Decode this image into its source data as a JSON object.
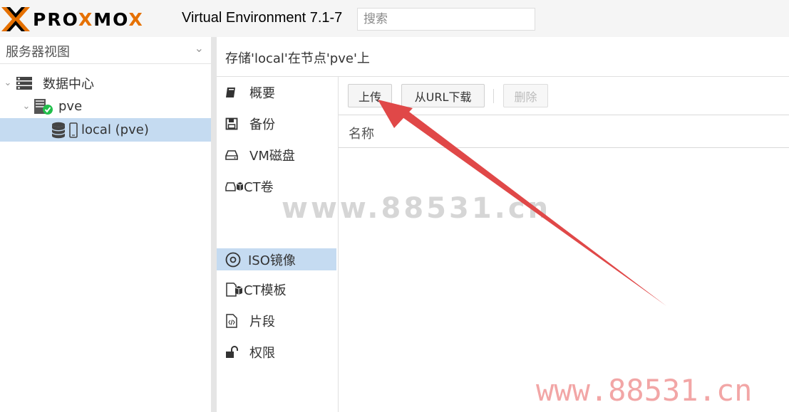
{
  "header": {
    "brand": "PROXMOX",
    "version": "Virtual Environment 7.1-7",
    "search_placeholder": "搜索"
  },
  "tree": {
    "view_selector": "服务器视图",
    "items": [
      {
        "label": "数据中心"
      },
      {
        "label": "pve"
      },
      {
        "label": "local (pve)"
      }
    ]
  },
  "content": {
    "title": "存储'local'在节点'pve'上",
    "nav": [
      {
        "label": "概要"
      },
      {
        "label": "备份"
      },
      {
        "label": "VM磁盘"
      },
      {
        "label": "CT卷"
      },
      {
        "label": "ISO镜像"
      },
      {
        "label": "CT模板"
      },
      {
        "label": "片段"
      },
      {
        "label": "权限"
      }
    ],
    "toolbar": {
      "upload": "上传",
      "download_url": "从URL下载",
      "delete": "删除"
    },
    "columns": {
      "name": "名称"
    }
  },
  "watermark": {
    "middle": "www.88531.cn",
    "bottom_right": "www.88531.cn"
  },
  "colors": {
    "selection": "#c5dbf1",
    "brand_orange": "#e57000",
    "arrow_red": "#e04848",
    "status_green": "#21bf4b"
  }
}
